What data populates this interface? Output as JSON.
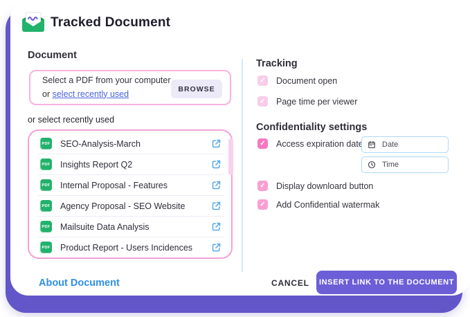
{
  "colors": {
    "purple-back": "#6256c8",
    "purple-btn": "#6c5ed6",
    "pink-border": "#f7b3de",
    "pink-border-strong": "#f3a2d8",
    "check-light": "#f8cde8",
    "check-mid": "#f99fd3",
    "check-bright": "#f678c2",
    "green": "#21b26b",
    "blue-link": "#2e90e6",
    "link-inline": "#4a63dd",
    "ext-blue": "#54a7ea",
    "input-border": "#aed8f6",
    "divider-v": "#d3e9fb",
    "row-divider": "#edeaf8",
    "lavender-btn": "#eceaf8",
    "scroll-thumb": "#f8d2ec",
    "text-dark": "#1e1e2a",
    "logo-purple": "#6c5dd3"
  },
  "header": {
    "title": "Tracked Document"
  },
  "document_section": {
    "heading": "Document",
    "pick_line1": "Select a PDF from your computer",
    "pick_prefix": "or ",
    "pick_link": "select recently used",
    "browse_label": "BROWSE",
    "recent_label": "or select recently used",
    "pdf_badge": "PDF",
    "recent_files": [
      {
        "name": "SEO-Analysis-March"
      },
      {
        "name": "Insights Report Q2"
      },
      {
        "name": "Internal Proposal - Features"
      },
      {
        "name": "Agency Proposal - SEO Website"
      },
      {
        "name": "Mailsuite Data Analysis"
      },
      {
        "name": "Product Report - Users Incidences"
      }
    ]
  },
  "tracking": {
    "heading": "Tracking",
    "options": [
      {
        "label": "Document open",
        "checked": true
      },
      {
        "label": "Page time per viewer",
        "checked": true
      }
    ]
  },
  "confidentiality": {
    "heading": "Confidentiality settings",
    "expiration": {
      "label": "Access expiration date",
      "checked": true,
      "date_placeholder": "Date",
      "time_placeholder": "Time"
    },
    "options": [
      {
        "label": "Display downloard button",
        "checked": true
      },
      {
        "label": "Add Confidential watermak",
        "checked": true
      }
    ]
  },
  "footer": {
    "about_label": "About Document",
    "cancel_label": "CANCEL",
    "insert_label": "INSERT LINK TO THE DOCUMENT"
  }
}
